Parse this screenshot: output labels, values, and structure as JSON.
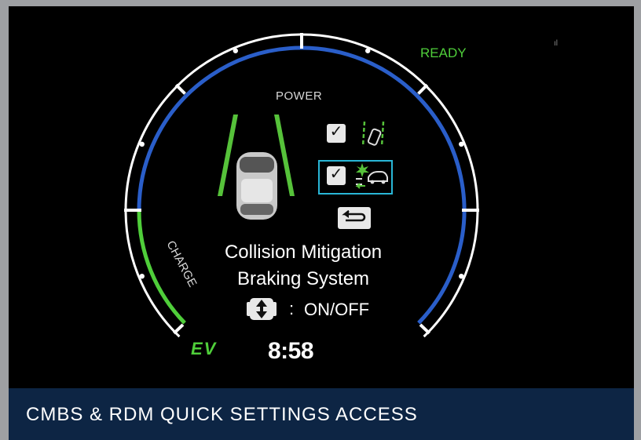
{
  "dash": {
    "power_label": "POWER",
    "charge_label": "CHARGE",
    "ready_label": "READY",
    "signal_glyph": "ıl",
    "ev_label": "EV",
    "clock": "8:58"
  },
  "menu": {
    "items": [
      {
        "checked": true,
        "icon": "road-departure-mitigation-icon",
        "selected": false
      },
      {
        "checked": true,
        "icon": "collision-mitigation-icon",
        "selected": true
      }
    ],
    "check_glyph": "✓",
    "back_icon": "return-icon"
  },
  "message": {
    "line1": "Collision Mitigation",
    "line2": "Braking System",
    "separator": ":",
    "action": "ON/OFF",
    "control_icon": "up-down-selector-icon"
  },
  "caption": "CMBS & RDM QUICK SETTINGS ACCESS",
  "colors": {
    "power_arc": "#2a5ec9",
    "charge_arc": "#4fce3a",
    "outer_ring": "#ffffff",
    "highlight_border": "#29b6d6",
    "ready": "#4fce3a",
    "footer_bg": "#0d2544"
  }
}
